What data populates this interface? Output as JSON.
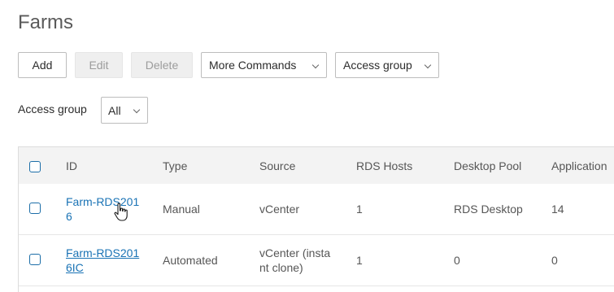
{
  "page": {
    "title": "Farms"
  },
  "toolbar": {
    "add": "Add",
    "edit": "Edit",
    "delete": "Delete",
    "more_commands": "More Commands",
    "access_group": "Access group"
  },
  "filter": {
    "label": "Access group",
    "value": "All"
  },
  "table": {
    "columns": [
      "ID",
      "Type",
      "Source",
      "RDS Hosts",
      "Desktop Pool",
      "Application"
    ],
    "rows": [
      {
        "id_line1": "Farm-RDS201",
        "id_line2": "6",
        "type": "Manual",
        "source_line1": "vCenter",
        "source_line2": "",
        "rds_hosts": "1",
        "desktop_pool": "RDS Desktop",
        "application": "14"
      },
      {
        "id_line1": "Farm-RDS201",
        "id_line2": "6IC",
        "type": "Automated",
        "source_line1": "vCenter (insta",
        "source_line2": "nt clone)",
        "rds_hosts": "1",
        "desktop_pool": "0",
        "application": "0"
      }
    ]
  },
  "colors": {
    "link": "#1a73b5",
    "checkbox": "#1c6ea8",
    "header_bg": "#f3f3f3"
  },
  "icons": {
    "cursor": "hand-pointer-icon",
    "dropdown": "chevron-down-icon"
  }
}
